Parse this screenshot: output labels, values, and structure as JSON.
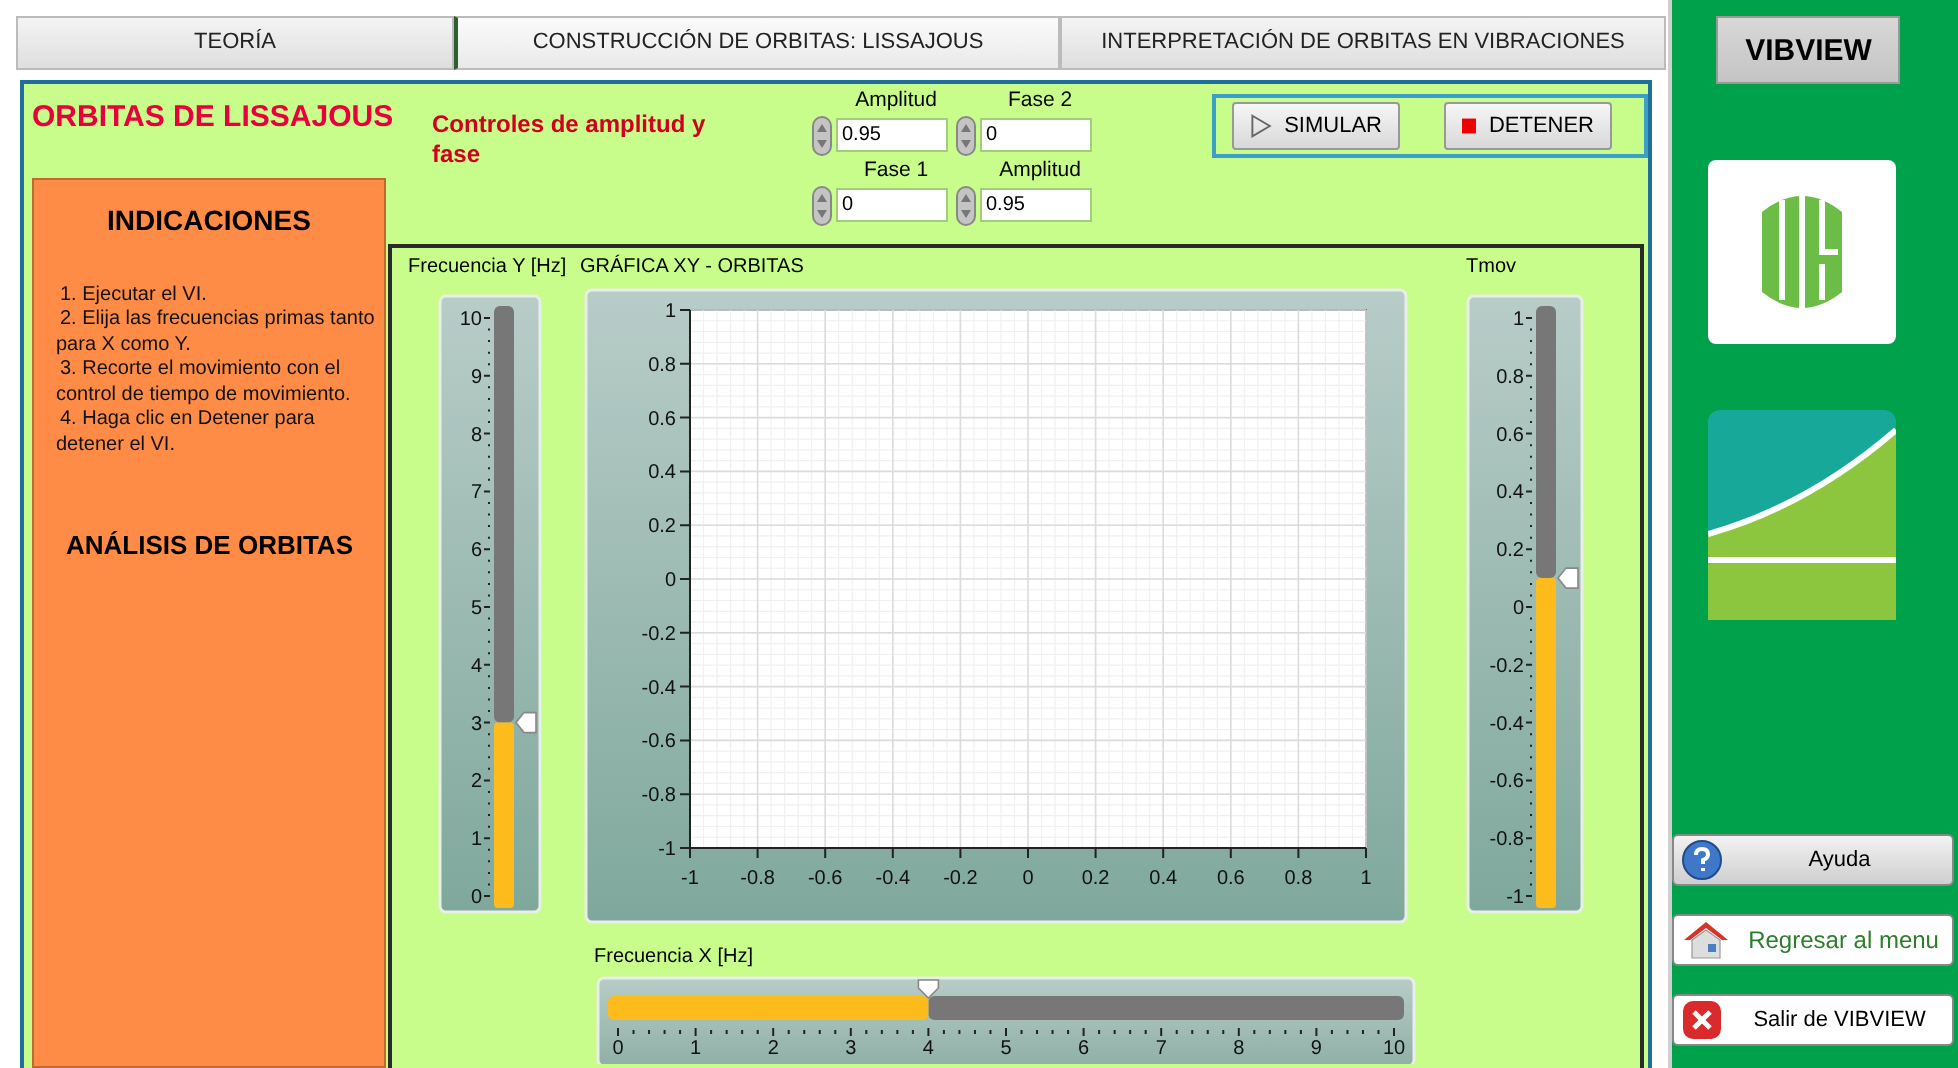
{
  "tabs": [
    {
      "label": "TEORÍA",
      "selected": false
    },
    {
      "label": "CONSTRUCCIÓN DE ORBITAS: LISSAJOUS",
      "selected": true
    },
    {
      "label": "INTERPRETACIÓN DE ORBITAS EN VIBRACIONES",
      "selected": false
    }
  ],
  "panel": {
    "title": "ORBITAS DE LISSAJOUS",
    "controls_label": "Controles de amplitud y fase"
  },
  "numerics": [
    {
      "label": "Amplitud",
      "value": "0.95"
    },
    {
      "label": "Fase 2",
      "value": "0"
    },
    {
      "label": "Fase 1",
      "value": "0"
    },
    {
      "label": "Amplitud",
      "value": "0.95"
    }
  ],
  "buttons": [
    {
      "kind": "play",
      "label": "SIMULAR"
    },
    {
      "kind": "stop",
      "label": "DETENER"
    }
  ],
  "instructions": {
    "heading": "INDICACIONES",
    "steps": [
      "1. Ejecutar el VI.",
      "2. Elija las frecuencias primas tanto para X como  Y.",
      "3. Recorte el movimiento con el control de tiempo de movimiento.",
      "4. Haga clic en Detener para detener el VI."
    ],
    "section": "ANÁLISIS DE ORBITAS"
  },
  "freq_y": {
    "label": "Frecuencia Y [Hz]",
    "level": 0.3,
    "scale": [
      "10",
      "9",
      "8",
      "7",
      "6",
      "5",
      "4",
      "3",
      "2",
      "1",
      "0"
    ]
  },
  "chart": {
    "title": "GRÁFICA XY - ORBITAS",
    "chart_data": {
      "type": "scatter",
      "grid": true,
      "xlim": [
        -1,
        1
      ],
      "ylim": [
        -1,
        1
      ],
      "xticks": [
        -1,
        -0.8,
        -0.6,
        -0.4,
        -0.2,
        0,
        0.2,
        0.4,
        0.6,
        0.8,
        1
      ],
      "yticks": [
        -1,
        -0.8,
        -0.6,
        -0.4,
        -0.2,
        0,
        0.2,
        0.4,
        0.6,
        0.8,
        1
      ]
    }
  },
  "tmov": {
    "label": "Tmov",
    "level": 0.55,
    "scale": [
      "1",
      "0.8",
      "0.6",
      "0.4",
      "0.2",
      "0",
      "-0.2",
      "-0.4",
      "-0.6",
      "-0.8",
      "-1"
    ]
  },
  "freq_x": {
    "label": "Frecuencia X [Hz]",
    "level": 0.4,
    "scale": [
      "0",
      "1",
      "2",
      "3",
      "4",
      "5",
      "6",
      "7",
      "8",
      "9",
      "10"
    ]
  },
  "sidebar": {
    "title": "VIBVIEW",
    "buttons": [
      {
        "kind": "help",
        "label": "Ayuda"
      },
      {
        "kind": "home",
        "label": "Regresar al menu"
      },
      {
        "kind": "exit",
        "label": "Salir de VIBVIEW"
      }
    ]
  }
}
